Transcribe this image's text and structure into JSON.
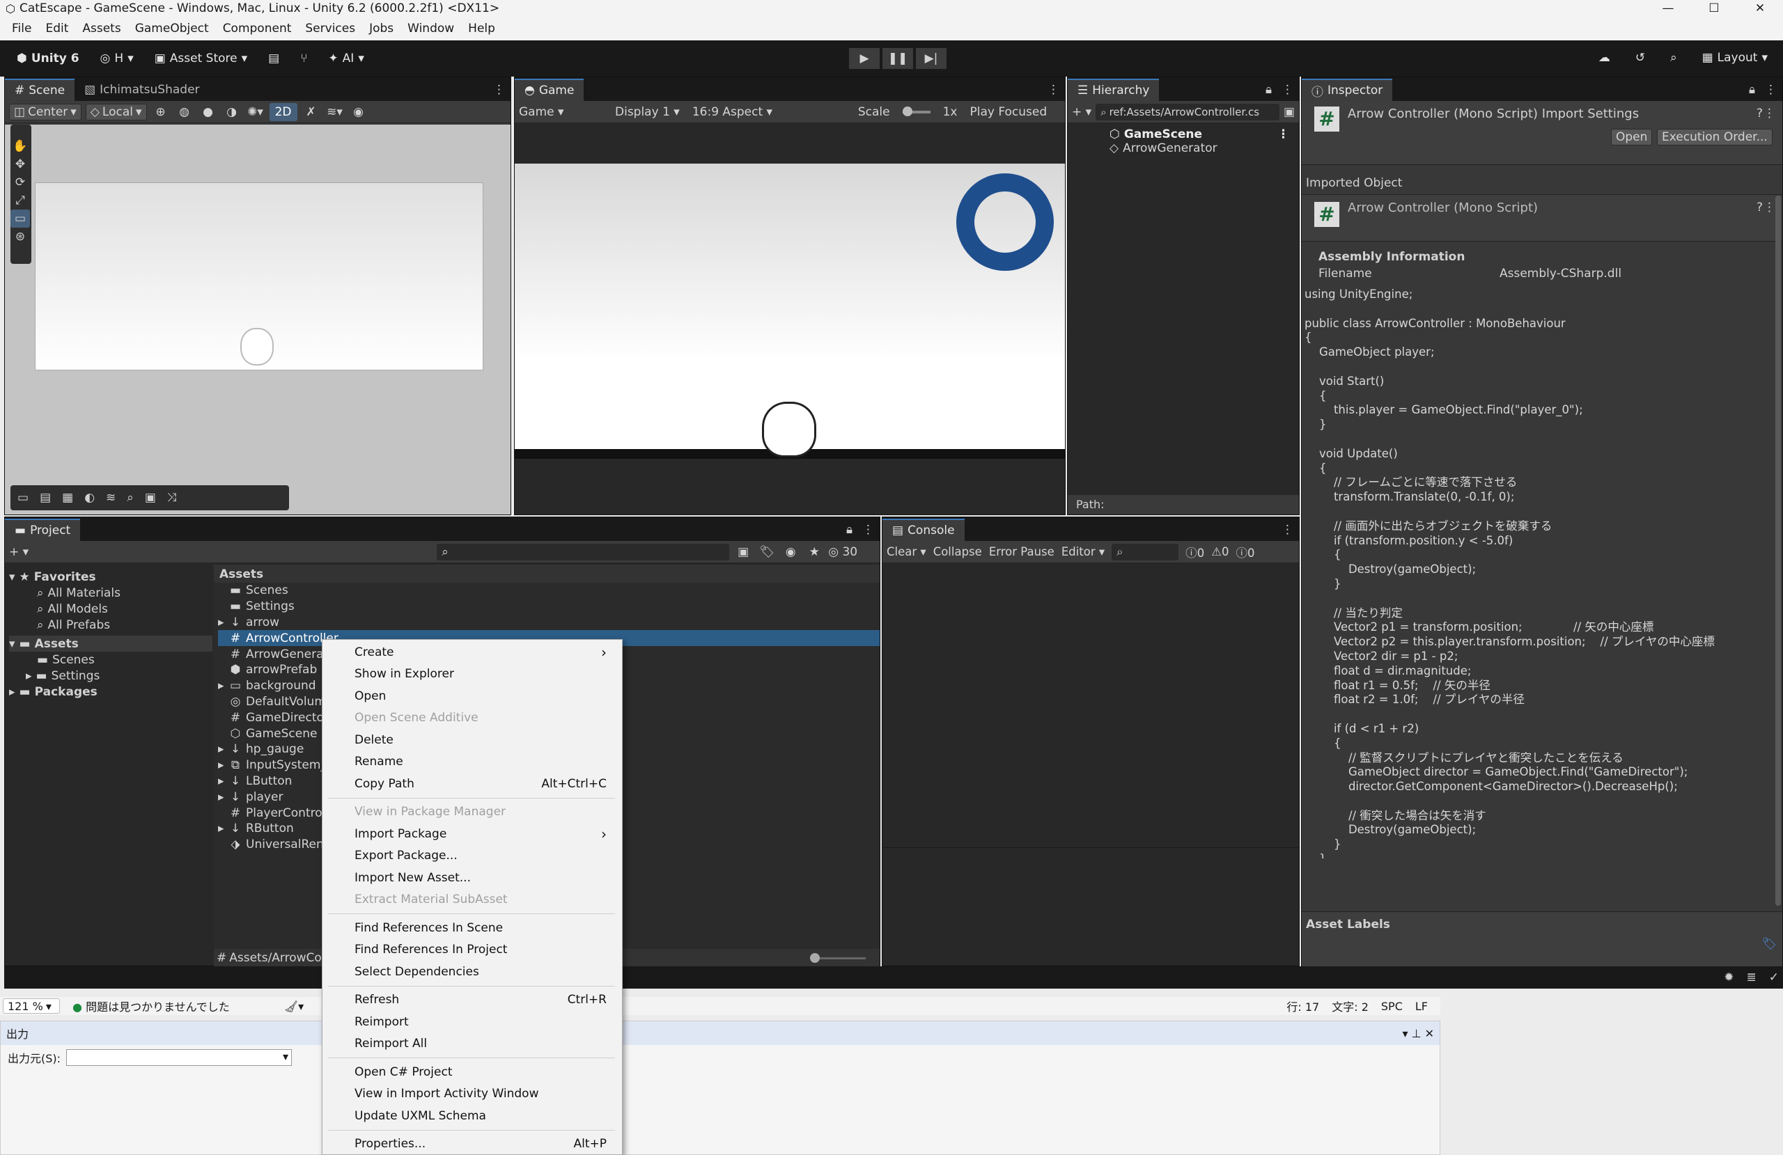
{
  "window": {
    "title": "CatEscape - GameScene - Windows, Mac, Linux - Unity 6.2 (6000.2.2f1) <DX11>"
  },
  "menu": [
    "File",
    "Edit",
    "Assets",
    "GameObject",
    "Component",
    "Services",
    "Jobs",
    "Window",
    "Help"
  ],
  "toolbar": {
    "unity": "Unity 6",
    "account": "H",
    "asset_store": "Asset Store",
    "ai": "AI",
    "layout": "Layout"
  },
  "scene": {
    "tabs": [
      "Scene",
      "IchimatsuShader"
    ],
    "center": "Center",
    "local": "Local",
    "mode2d": "2D"
  },
  "game": {
    "tab": "Game",
    "view": "Game",
    "display": "Display 1",
    "aspect": "16:9 Aspect",
    "scale_label": "Scale",
    "scale_value": "1x",
    "play_focused": "Play Focused"
  },
  "hierarchy": {
    "tab": "Hierarchy",
    "search": "ref:Assets/ArrowController.cs",
    "scene": "GameScene",
    "items": [
      "ArrowGenerator"
    ],
    "path_label": "Path:"
  },
  "inspector": {
    "tab": "Inspector",
    "header": "Arrow Controller (Mono Script) Import Settings",
    "open": "Open",
    "exec_order": "Execution Order...",
    "imported_object": "Imported Object",
    "object_name": "Arrow Controller (Mono Script)",
    "assembly_title": "Assembly Information",
    "filename_label": "Filename",
    "filename_value": "Assembly-CSharp.dll",
    "asset_labels": "Asset Labels",
    "code": [
      "using UnityEngine;",
      "",
      "public class ArrowController : MonoBehaviour",
      "{",
      "    GameObject player;",
      "",
      "    void Start()",
      "    {",
      "        this.player = GameObject.Find(\"player_0\");",
      "    }",
      "",
      "    void Update()",
      "    {",
      "        // フレームごとに等速で落下させる",
      "        transform.Translate(0, -0.1f, 0);",
      "",
      "        // 画面外に出たらオブジェクトを破棄する",
      "        if (transform.position.y < -5.0f)",
      "        {",
      "            Destroy(gameObject);",
      "        }",
      "",
      "        // 当たり判定",
      "        Vector2 p1 = transform.position;              // 矢の中心座標",
      "        Vector2 p2 = this.player.transform.position;    // プレイヤの中心座標",
      "        Vector2 dir = p1 - p2;",
      "        float d = dir.magnitude;",
      "        float r1 = 0.5f;    // 矢の半径",
      "        float r2 = 1.0f;    // プレイヤの半径",
      "",
      "        if (d < r1 + r2)",
      "        {",
      "            // 監督スクリプトにプレイヤと衝突したことを伝える",
      "            GameObject director = GameObject.Find(\"GameDirector\");",
      "            director.GetComponent<GameDirector>().DecreaseHp();",
      "",
      "            // 衝突した場合は矢を消す",
      "            Destroy(gameObject);",
      "        }",
      "    }",
      "}"
    ]
  },
  "project": {
    "tab": "Project",
    "hidden_count": "30",
    "favorites": "Favorites",
    "fav_items": [
      "All Materials",
      "All Models",
      "All Prefabs"
    ],
    "assets": "Assets",
    "asset_folders": [
      "Scenes",
      "Settings"
    ],
    "packages": "Packages",
    "breadcrumb": "Assets",
    "files": [
      "Scenes",
      "Settings",
      "arrow",
      "ArrowController",
      "ArrowGenera",
      "arrowPrefab",
      "background",
      "DefaultVolum",
      "GameDirecto",
      "GameScene",
      "hp_gauge",
      "InputSystem_",
      "LButton",
      "player",
      "PlayerContro",
      "RButton",
      "UniversalRen"
    ],
    "footer_path": "Assets/ArrowCo"
  },
  "console": {
    "tab": "Console",
    "clear": "Clear",
    "collapse": "Collapse",
    "error_pause": "Error Pause",
    "editor": "Editor",
    "c1": "0",
    "c2": "0",
    "c3": "0"
  },
  "context_menu": [
    {
      "label": "Create",
      "shortcut": "",
      "arrow": true
    },
    {
      "label": "Show in Explorer",
      "shortcut": ""
    },
    {
      "label": "Open",
      "shortcut": ""
    },
    {
      "label": "Open Scene Additive",
      "shortcut": "",
      "disabled": true
    },
    {
      "label": "Delete",
      "shortcut": ""
    },
    {
      "label": "Rename",
      "shortcut": ""
    },
    {
      "label": "Copy Path",
      "shortcut": "Alt+Ctrl+C"
    },
    {
      "sep": true
    },
    {
      "label": "View in Package Manager",
      "shortcut": "",
      "disabled": true
    },
    {
      "label": "Import Package",
      "shortcut": "",
      "arrow": true
    },
    {
      "label": "Export Package...",
      "shortcut": ""
    },
    {
      "label": "Import New Asset...",
      "shortcut": ""
    },
    {
      "label": "Extract Material SubAsset",
      "shortcut": "",
      "disabled": true
    },
    {
      "sep": true
    },
    {
      "label": "Find References In Scene",
      "shortcut": ""
    },
    {
      "label": "Find References In Project",
      "shortcut": ""
    },
    {
      "label": "Select Dependencies",
      "shortcut": ""
    },
    {
      "sep": true
    },
    {
      "label": "Refresh",
      "shortcut": "Ctrl+R"
    },
    {
      "label": "Reimport",
      "shortcut": ""
    },
    {
      "label": "Reimport All",
      "shortcut": ""
    },
    {
      "sep": true
    },
    {
      "label": "Open C# Project",
      "shortcut": ""
    },
    {
      "label": "View in Import Activity Window",
      "shortcut": ""
    },
    {
      "label": "Update UXML Schema",
      "shortcut": ""
    },
    {
      "sep": true
    },
    {
      "label": "Properties...",
      "shortcut": "Alt+P"
    }
  ],
  "vs": {
    "zoom": "121 %",
    "no_issues": "問題は見つかりませんでした",
    "line": "行: 17",
    "col": "文字: 2",
    "spc": "SPC",
    "lf": "LF",
    "output_title": "出力",
    "output_from": "出力元(S):"
  },
  "colors": {
    "accent": "#3a79bb",
    "selection": "#2c5d87",
    "ring": "#1f4e8d"
  }
}
